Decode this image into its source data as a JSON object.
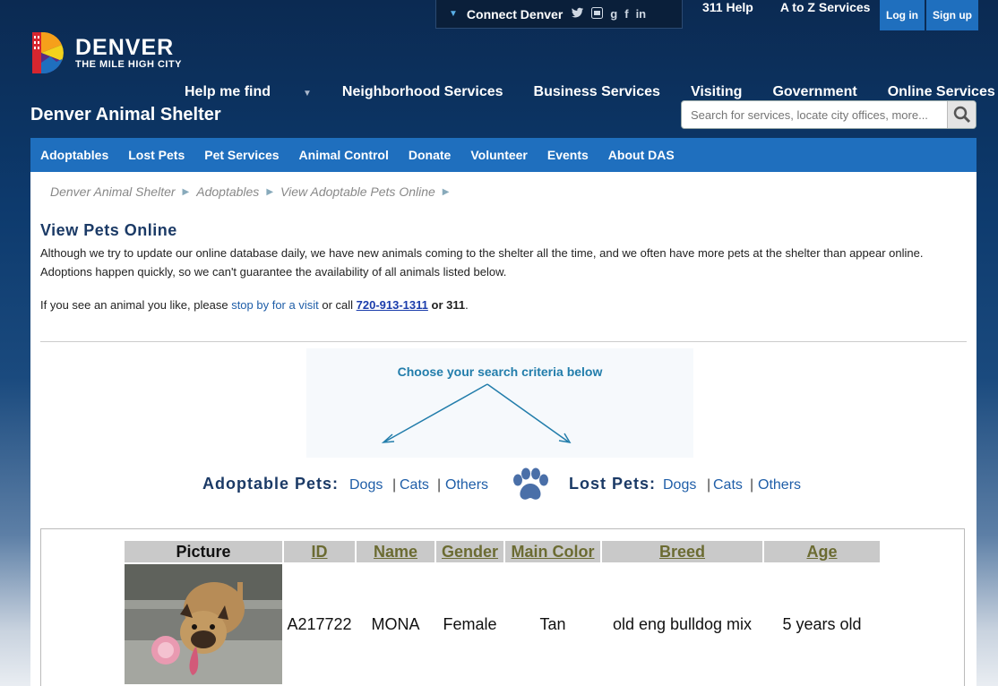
{
  "header": {
    "connect_label": "Connect Denver",
    "social_icons": [
      "twitter-icon",
      "youtube-icon",
      "googleplus-icon",
      "facebook-icon",
      "linkedin-icon"
    ],
    "top_links": [
      "311 Help",
      "A to Z Services"
    ],
    "login_label": "Log in",
    "signup_label": "Sign up",
    "logo_title": "DENVER",
    "logo_subtitle": "THE MILE HIGH CITY"
  },
  "main_nav": {
    "items": [
      "Help me find",
      "Neighborhood Services",
      "Business Services",
      "Visiting",
      "Government",
      "Online Services"
    ]
  },
  "site_title": "Denver Animal Shelter",
  "search": {
    "placeholder": "Search for services, locate city offices, more..."
  },
  "sub_nav": {
    "items": [
      "Adoptables",
      "Lost Pets",
      "Pet Services",
      "Animal Control",
      "Donate",
      "Volunteer",
      "Events",
      "About DAS"
    ]
  },
  "breadcrumb": [
    "Denver Animal Shelter",
    "Adoptables",
    "View Adoptable Pets Online"
  ],
  "page": {
    "title": "View Pets Online",
    "intro": "Although we try to update our online database daily, we have new animals coming to the shelter all the time, and we often have more pets at the shelter than appear online. Adoptions happen quickly, so we can't guarantee the availability of all animals listed below.",
    "visit_prefix": "If you see an animal you like, please ",
    "visit_link": "stop by for a visit",
    "visit_mid": " or call ",
    "phone": "720-913-1311",
    "visit_or": " or 311",
    "visit_end": "."
  },
  "criteria": {
    "heading": "Choose your search criteria below",
    "adoptable_label": "Adoptable Pets",
    "lost_label": "Lost Pets",
    "links": [
      "Dogs",
      "Cats",
      "Others"
    ]
  },
  "results": {
    "columns": [
      "Picture",
      "ID",
      "Name",
      "Gender",
      "Main Color",
      "Breed",
      "Age"
    ],
    "rows": [
      {
        "id": "A217722",
        "name": "MONA",
        "gender": "Female",
        "color": "Tan",
        "breed": "old eng bulldog mix",
        "age": "5 years old"
      }
    ]
  },
  "colors": {
    "nav_blue": "#1f6fbe",
    "title_navy": "#1b3a66",
    "link_blue": "#1f5ea8",
    "accent_teal": "#227dab"
  }
}
